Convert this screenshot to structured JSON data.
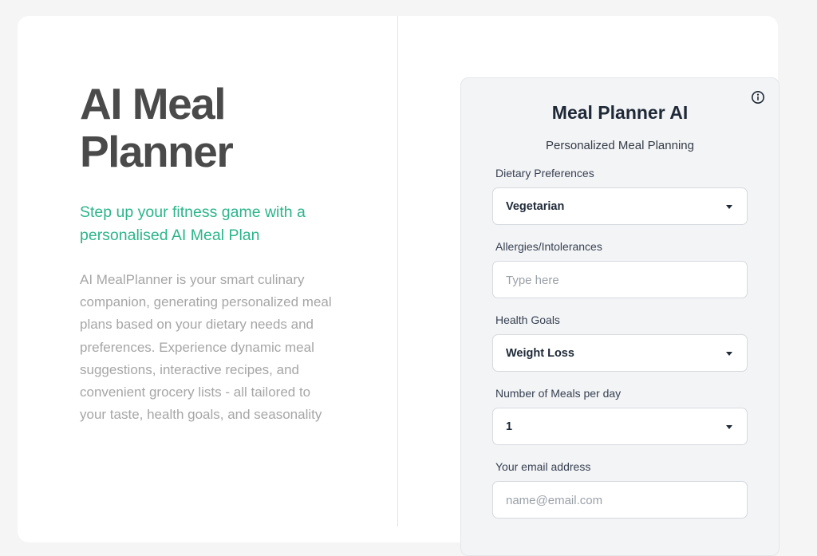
{
  "hero": {
    "title": "AI Meal Planner",
    "subtitle": "Step up your fitness game with a personalised AI Meal Plan",
    "description": "AI MealPlanner is your smart culinary companion, generating personalized meal plans based on your dietary needs and preferences. Experience dynamic meal suggestions, interactive recipes, and convenient grocery lists - all tailored to your taste, health goals, and seasonality"
  },
  "panel": {
    "title": "Meal Planner AI",
    "subtitle": "Personalized Meal Planning",
    "info_icon": "info-circle-icon",
    "fields": {
      "dietary": {
        "label": "Dietary Preferences",
        "value": "Vegetarian"
      },
      "allergies": {
        "label": "Allergies/Intolerances",
        "placeholder": "Type here"
      },
      "goals": {
        "label": "Health Goals",
        "value": "Weight Loss"
      },
      "meals": {
        "label": "Number of Meals per day",
        "value": "1"
      },
      "email": {
        "label": "Your email address",
        "placeholder": "name@email.com"
      }
    }
  },
  "colors": {
    "accent": "#2bb58a",
    "heading": "#4a4a4a",
    "muted": "#a6a6a6",
    "panel_bg": "#f3f4f6"
  }
}
